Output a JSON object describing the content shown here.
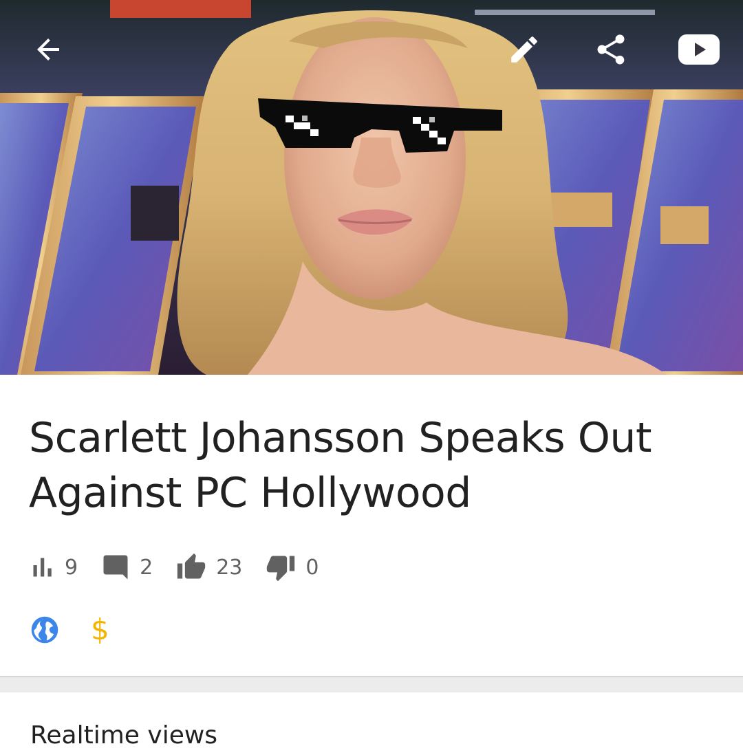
{
  "video": {
    "title": "Scarlett Johansson Speaks Out Against PC Hollywood",
    "thumbnail_description": "portrait-with-pixel-sunglasses-meme"
  },
  "toolbar": {
    "back_icon": "arrow-back-icon",
    "edit_icon": "pencil-icon",
    "share_icon": "share-icon",
    "youtube_icon": "youtube-icon",
    "icon_color": "#ffffff"
  },
  "stats": {
    "views": "9",
    "comments": "2",
    "likes": "23",
    "dislikes": "0",
    "icon_color": "#616161"
  },
  "badges": {
    "public_icon": "globe-icon",
    "public_color": "#3b86e8",
    "monetization_symbol": "$",
    "monetization_color": "#f6b400"
  },
  "realtime": {
    "heading": "Realtime views"
  }
}
